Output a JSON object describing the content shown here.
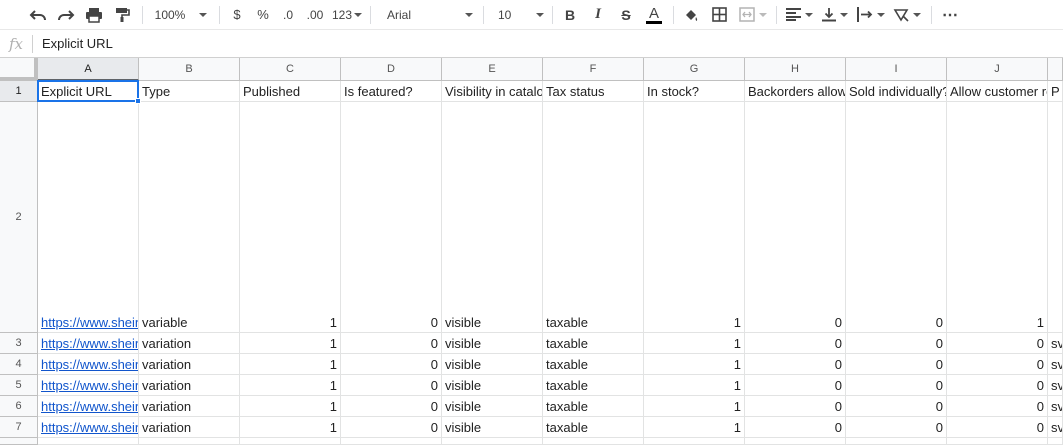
{
  "toolbar": {
    "zoom": "100%",
    "currency": "$",
    "percent": "%",
    "decrease_decimals": ".0",
    "increase_decimals": ".00",
    "more_formats": "123",
    "font": "Arial",
    "font_size": "10",
    "bold": "B",
    "italic": "I",
    "strike": "S",
    "text_color": "A",
    "more": "⋯"
  },
  "formula_bar": {
    "fx": "fx",
    "content": "Explicit URL"
  },
  "columns": [
    "A",
    "B",
    "C",
    "D",
    "E",
    "F",
    "G",
    "H",
    "I",
    "J"
  ],
  "rows": [
    "1",
    "2",
    "3",
    "4",
    "5",
    "6",
    "7"
  ],
  "header_row": [
    "Explicit URL",
    "Type",
    "Published",
    "Is featured?",
    "Visibility in catalog",
    "Tax status",
    "In stock?",
    "Backorders allowed?",
    "Sold individually?",
    "Allow customer reviews?",
    "P"
  ],
  "data_rows": [
    [
      "https://www.shein",
      "variable",
      "1",
      "0",
      "visible",
      "taxable",
      "1",
      "0",
      "0",
      "1",
      ""
    ],
    [
      "https://www.shein",
      "variation",
      "1",
      "0",
      "visible",
      "taxable",
      "1",
      "0",
      "0",
      "0",
      "sv"
    ],
    [
      "https://www.shein",
      "variation",
      "1",
      "0",
      "visible",
      "taxable",
      "1",
      "0",
      "0",
      "0",
      "sv"
    ],
    [
      "https://www.shein",
      "variation",
      "1",
      "0",
      "visible",
      "taxable",
      "1",
      "0",
      "0",
      "0",
      "sv"
    ],
    [
      "https://www.shein",
      "variation",
      "1",
      "0",
      "visible",
      "taxable",
      "1",
      "0",
      "0",
      "0",
      "sv"
    ],
    [
      "https://www.shein",
      "variation",
      "1",
      "0",
      "visible",
      "taxable",
      "1",
      "0",
      "0",
      "0",
      "sv"
    ]
  ],
  "colors": {
    "accent": "#1a73e8",
    "link": "#1155cc",
    "header_bg": "#f8f9fa"
  }
}
